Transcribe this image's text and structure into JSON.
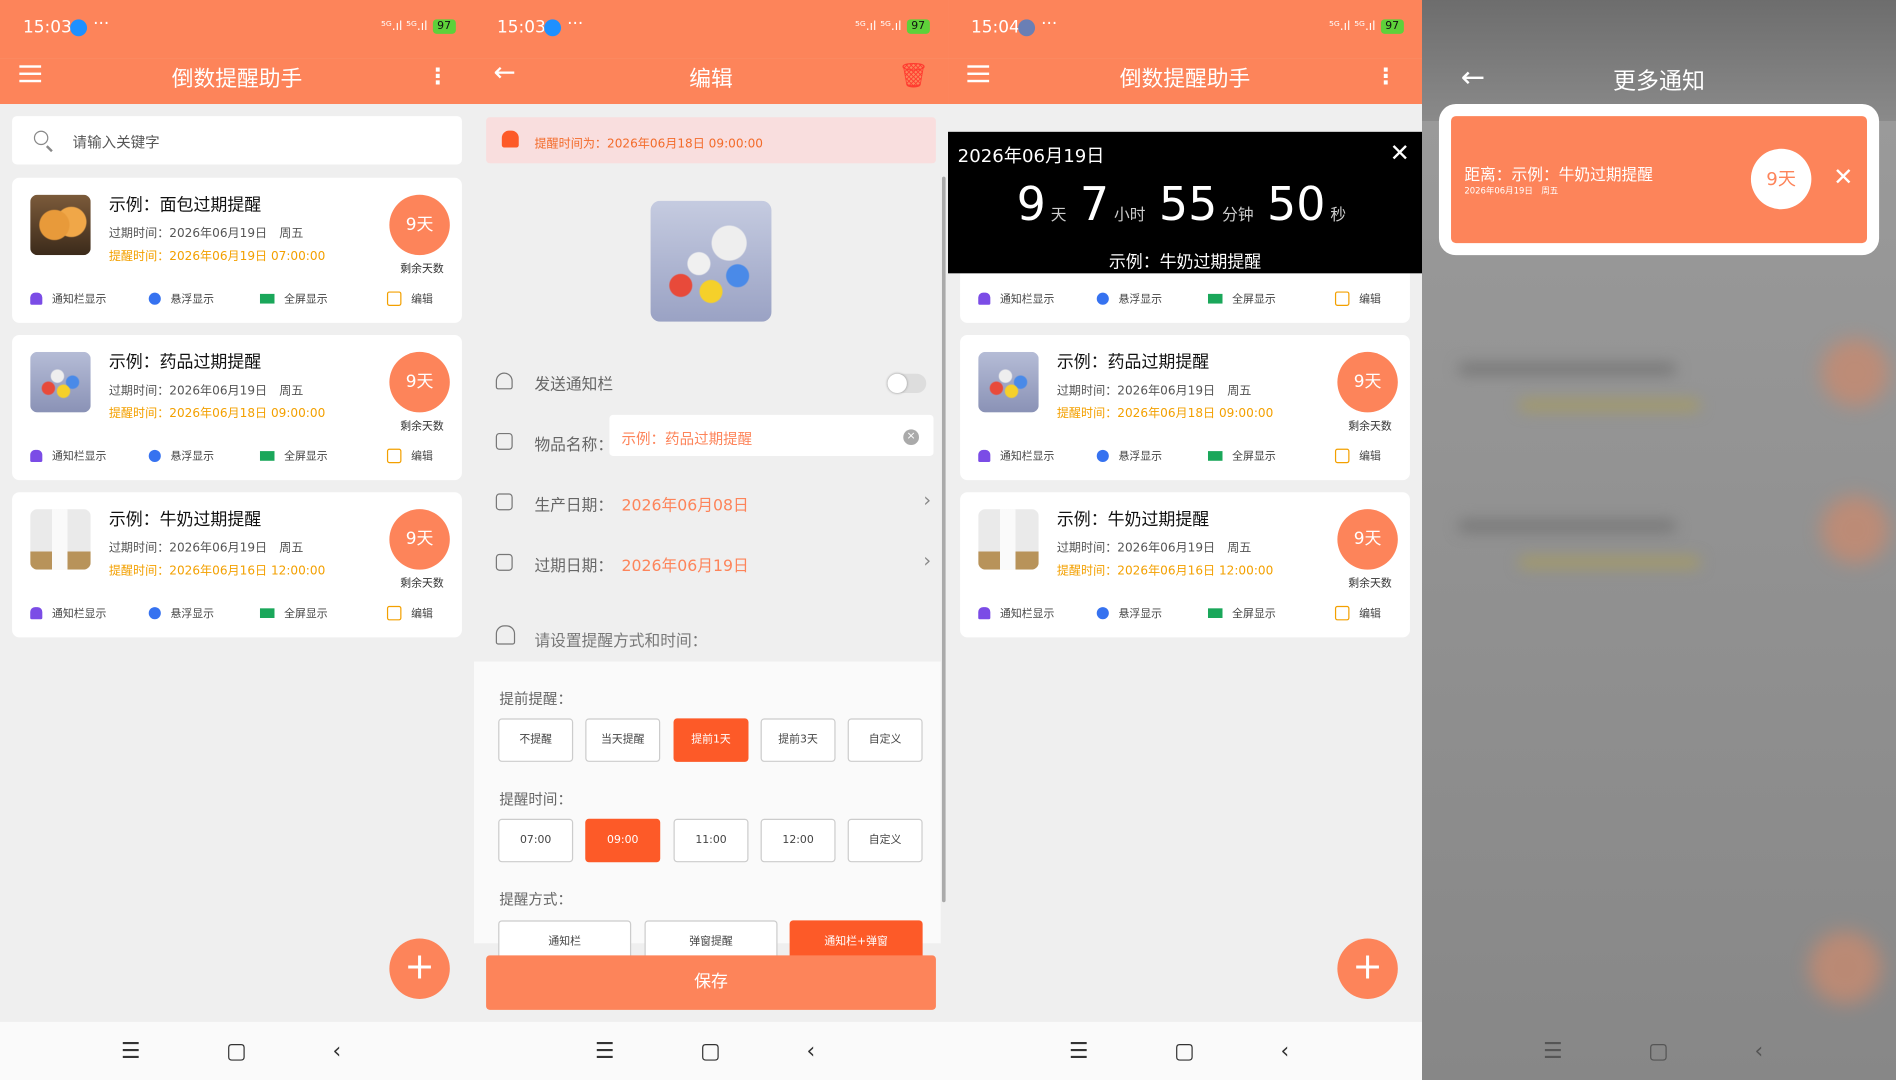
{
  "colors": {
    "accent": "#fd845a",
    "warning": "#f3a000",
    "danger": "#ff3b30"
  },
  "status": {
    "time_1": "15:03",
    "time_2": "15:03",
    "time_3": "15:04",
    "signal": "⁵ᴳ.ıl ⁵ᴳ.ıl",
    "battery": "97"
  },
  "list": {
    "title": "倒数提醒助手",
    "search_placeholder": "请输入关键字",
    "days_label": "剩余天数",
    "opt_notify": "通知栏显示",
    "opt_float": "悬浮显示",
    "opt_full": "全屏显示",
    "opt_edit": "编辑",
    "items": [
      {
        "name": "示例：面包过期提醒",
        "expire": "过期时间：2026年06月19日　周五",
        "remind": "提醒时间：2026年06月19日 07:00:00",
        "days": "9天"
      },
      {
        "name": "示例：药品过期提醒",
        "expire": "过期时间：2026年06月19日　周五",
        "remind": "提醒时间：2026年06月18日 09:00:00",
        "days": "9天"
      },
      {
        "name": "示例：牛奶过期提醒",
        "expire": "过期时间：2026年06月19日　周五",
        "remind": "提醒时间：2026年06月16日 12:00:00",
        "days": "9天"
      }
    ],
    "fab": "+"
  },
  "edit": {
    "title": "编辑",
    "alert": "提醒时间为：2026年06月18日 09:00:00",
    "send_notify": "发送通知栏",
    "name_label": "物品名称：",
    "name_value": "示例：药品过期提醒",
    "prod_label": "生产日期：",
    "prod_value": "2026年06月08日",
    "exp_label": "过期日期：",
    "exp_value": "2026年06月19日",
    "set_label": "请设置提醒方式和时间：",
    "advance_label": "提前提醒：",
    "advance": [
      "不提醒",
      "当天提醒",
      "提前1天",
      "提前3天",
      "自定义"
    ],
    "time_label": "提醒时间：",
    "times": [
      "07:00",
      "09:00",
      "11:00",
      "12:00",
      "自定义"
    ],
    "mode_label": "提醒方式：",
    "modes": [
      "通知栏",
      "弹窗提醒",
      "通知栏+弹窗"
    ],
    "save": "保存"
  },
  "overlay": {
    "date": "2026年06月19日",
    "d": "9",
    "d_u": "天",
    "h": "7",
    "h_u": "小时",
    "m": "55",
    "m_u": "分钟",
    "s": "50",
    "s_u": "秒",
    "name": "示例：牛奶过期提醒"
  },
  "more": {
    "title": "更多通知",
    "text": "距离：示例：牛奶过期提醒",
    "date": "2026年06月19日　周五",
    "days": "9天"
  }
}
